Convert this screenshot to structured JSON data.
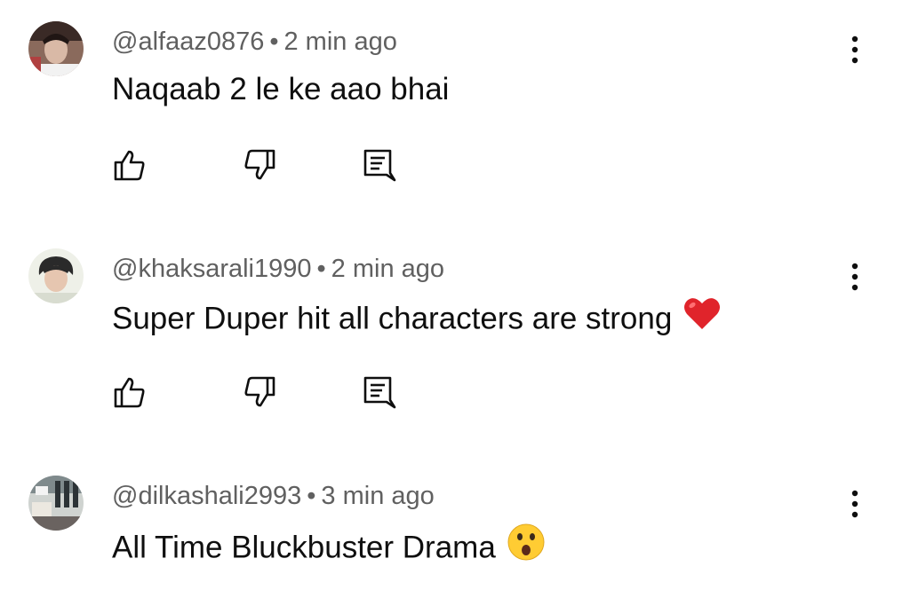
{
  "comments": [
    {
      "handle": "@alfaaz0876",
      "separator": "•",
      "time": "2 min ago",
      "text": "Naqaab 2 le ke aao bhai",
      "emoji": ""
    },
    {
      "handle": "@khaksarali1990",
      "separator": "•",
      "time": "2 min ago",
      "text": "Super Duper hit all characters are strong",
      "emoji": "red-heart-emoji"
    },
    {
      "handle": "@dilkashali2993",
      "separator": "•",
      "time": "3 min ago",
      "text": "All Time Bluckbuster Drama",
      "emoji": "astonished-face-emoji"
    }
  ],
  "icons": {
    "like": "thumbs-up-icon",
    "dislike": "thumbs-down-icon",
    "reply": "reply-comment-icon",
    "more": "more-vertical-icon"
  },
  "colors": {
    "text": "#0f0f0f",
    "meta": "#606060",
    "icon": "#0f0f0f",
    "heart": "#e0242b",
    "emoji_face": "#ffcc33"
  }
}
